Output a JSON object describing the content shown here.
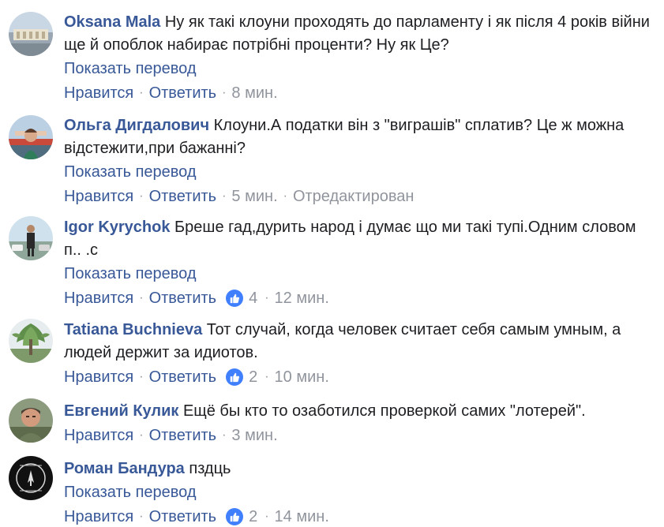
{
  "comments": [
    {
      "author": "Oksana Mala",
      "text": "Ну як такі клоуни проходять до парламенту і як після 4 років війни ще й опоблок набирає потрібні проценти? Ну як Це?",
      "translate": "Показать перевод",
      "like_label": "Нравится",
      "reply_label": "Ответить",
      "time": "8 мин."
    },
    {
      "author": "Ольга Дигдалович",
      "text": "Клоуни.А податки він з \"виграшів\" сплатив? Це ж можна відстежити,при бажанні?",
      "translate": "Показать перевод",
      "like_label": "Нравится",
      "reply_label": "Ответить",
      "time": "5 мин.",
      "edited": "Отредактирован"
    },
    {
      "author": "Igor Kyrychok",
      "text": "Бреше гад,дурить народ і думає що ми такі тупі.Одним словом п.. .с",
      "translate": "Показать перевод",
      "like_label": "Нравится",
      "reply_label": "Ответить",
      "likes": "4",
      "time": "12 мин."
    },
    {
      "author": "Tatiana Buchnieva",
      "text": "Тот случай, когда человек считает себя самым умным, а людей держит за идиотов.",
      "like_label": "Нравится",
      "reply_label": "Ответить",
      "likes": "2",
      "time": "10 мин."
    },
    {
      "author": "Евгений Кулик",
      "text": "Ещё бы кто то озаботился проверкой самих \"лотерей\".",
      "like_label": "Нравится",
      "reply_label": "Ответить",
      "time": "3 мин."
    },
    {
      "author": "Роман Бандура",
      "text": "пздць",
      "translate": "Показать перевод",
      "like_label": "Нравится",
      "reply_label": "Ответить",
      "likes": "2",
      "time": "14 мин."
    }
  ],
  "separator": "·",
  "colors": {
    "link": "#385898",
    "meta": "#90949c",
    "text": "#1c1e21",
    "like_badge": "#4080ff"
  },
  "icons": {
    "like_badge": "thumbs-up-icon"
  }
}
